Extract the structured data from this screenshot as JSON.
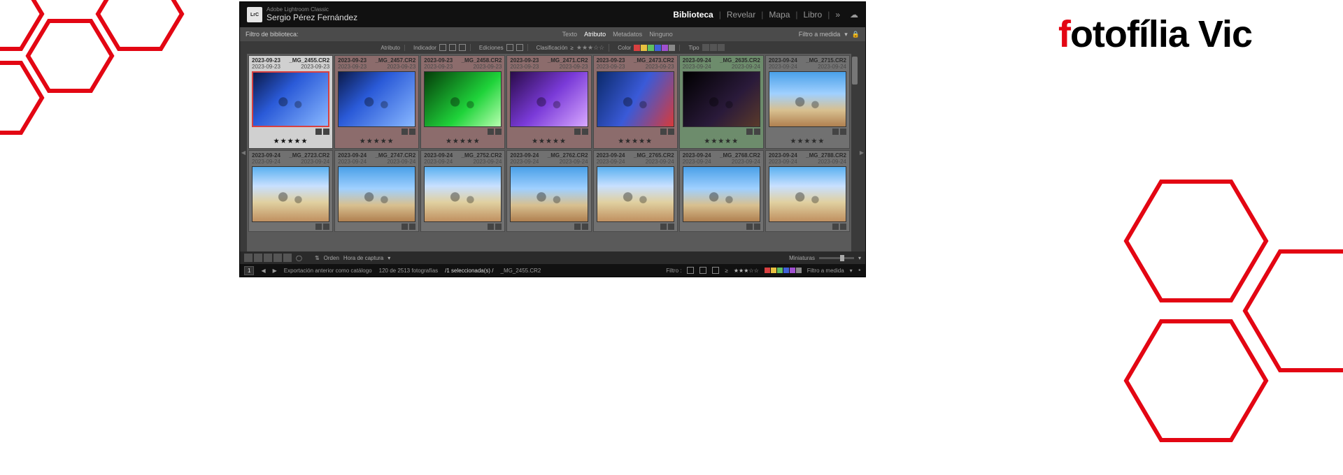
{
  "header": {
    "badge": "LrC",
    "subtitle": "Adobe Lightroom Classic",
    "title": "Sergio Pérez Fernández",
    "nav": [
      "Biblioteca",
      "Revelar",
      "Mapa",
      "Libro"
    ],
    "nav_active": 0,
    "more_glyph": "»"
  },
  "filter_strip": {
    "label": "Filtro de biblioteca:",
    "tabs": [
      "Texto",
      "Atributo",
      "Metadatos",
      "Ninguno"
    ],
    "tabs_active": 1,
    "preset": "Filtro a medida"
  },
  "attr_bar": {
    "section1": "Atributo",
    "section2": "Indicador",
    "section3": "Ediciones",
    "section4": "Clasificación",
    "section5": "Color",
    "section6": "Tipo",
    "op": "≥",
    "stars": "★★★☆☆",
    "colors": [
      "#d84040",
      "#e8c040",
      "#60c060",
      "#4060d8",
      "#a050d0",
      "#888"
    ]
  },
  "thumbs_row1": [
    {
      "date": "2023-09-23",
      "file": "_MG_2455.CR2",
      "date2": "2023-09-23",
      "tint": "sel",
      "thumb": "th-concert-blue",
      "rating": "★★★★★"
    },
    {
      "date": "2023-09-23",
      "file": "_MG_2457.CR2",
      "date2": "2023-09-23",
      "tint": "red-tint",
      "thumb": "th-concert-blue",
      "rating": "★★★★★"
    },
    {
      "date": "2023-09-23",
      "file": "_MG_2458.CR2",
      "date2": "2023-09-23",
      "tint": "red-tint",
      "thumb": "th-concert-green",
      "rating": "★★★★★"
    },
    {
      "date": "2023-09-23",
      "file": "_MG_2471.CR2",
      "date2": "2023-09-23",
      "tint": "red-tint",
      "thumb": "th-concert-purple",
      "rating": "★★★★★"
    },
    {
      "date": "2023-09-23",
      "file": "_MG_2473.CR2",
      "date2": "2023-09-23",
      "tint": "red-tint",
      "thumb": "th-concert-bluered",
      "rating": "★★★★★"
    },
    {
      "date": "2023-09-24",
      "file": "_MG_2635.CR2",
      "date2": "2023-09-24",
      "tint": "green-tint",
      "thumb": "th-concert-dark",
      "rating": "★★★★★"
    },
    {
      "date": "2023-09-24",
      "file": "_MG_2715.CR2",
      "date2": "2023-09-24",
      "tint": "",
      "thumb": "th-castell",
      "rating": "★★★★★"
    }
  ],
  "thumbs_row2": [
    {
      "date": "2023-09-24",
      "file": "_MG_2723.CR2",
      "date2": "2023-09-24",
      "tint": "",
      "thumb": "th-castell2"
    },
    {
      "date": "2023-09-24",
      "file": "_MG_2747.CR2",
      "date2": "2023-09-24",
      "tint": "",
      "thumb": "th-castell"
    },
    {
      "date": "2023-09-24",
      "file": "_MG_2752.CR2",
      "date2": "2023-09-24",
      "tint": "",
      "thumb": "th-castell2"
    },
    {
      "date": "2023-09-24",
      "file": "_MG_2762.CR2",
      "date2": "2023-09-24",
      "tint": "",
      "thumb": "th-castell"
    },
    {
      "date": "2023-09-24",
      "file": "_MG_2765.CR2",
      "date2": "2023-09-24",
      "tint": "",
      "thumb": "th-castell2"
    },
    {
      "date": "2023-09-24",
      "file": "_MG_2768.CR2",
      "date2": "2023-09-24",
      "tint": "",
      "thumb": "th-castell"
    },
    {
      "date": "2023-09-24",
      "file": "_MG_2788.CR2",
      "date2": "2023-09-24",
      "tint": "",
      "thumb": "th-castell2"
    }
  ],
  "btm": {
    "sort_label": "Orden",
    "sort_value": "Hora de captura",
    "thumb_label": "Miniaturas"
  },
  "status": {
    "page": "1",
    "export": "Exportación anterior como catálogo",
    "count": "120 de 2513 fotografías",
    "selected": "/1 seleccionada(s) /",
    "selfile": "_MG_2455.CR2",
    "filter_label": "Filtro :",
    "op": "≥",
    "stars": "★★★☆☆",
    "preset": "Filtro a medida",
    "colors": [
      "#d84040",
      "#e8c040",
      "#60c060",
      "#4060d8",
      "#a050d0",
      "#888"
    ]
  },
  "logo": {
    "f": "f",
    "rest": "otofília Vic"
  }
}
